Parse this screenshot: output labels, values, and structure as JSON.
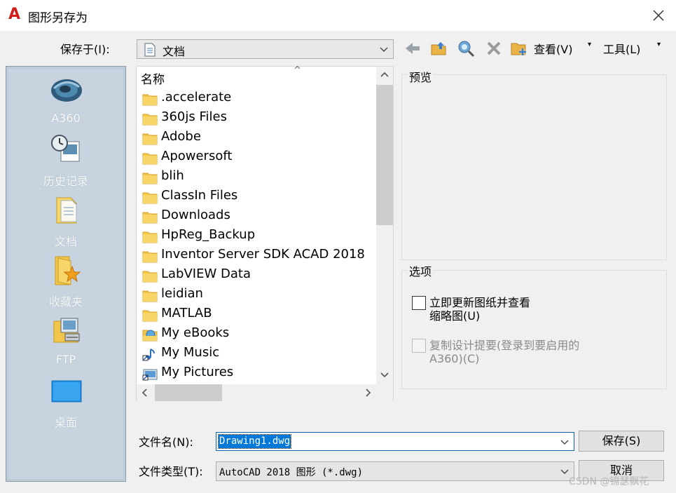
{
  "window": {
    "title": "图形另存为",
    "close_icon": "close-icon"
  },
  "toolbar": {
    "save_in_label": "保存于(I):",
    "location": "文档",
    "view_label": "查看(V)",
    "tools_label": "工具(L)",
    "icons": [
      "back-icon",
      "up-folder-icon",
      "search-web-icon",
      "delete-icon",
      "new-folder-icon"
    ]
  },
  "places": [
    {
      "label": "A360",
      "icon": "a360-icon"
    },
    {
      "label": "历史记录",
      "icon": "history-icon"
    },
    {
      "label": "文档",
      "icon": "documents-icon"
    },
    {
      "label": "收藏夹",
      "icon": "favorites-icon"
    },
    {
      "label": "FTP",
      "icon": "ftp-icon"
    },
    {
      "label": "桌面",
      "icon": "desktop-icon"
    }
  ],
  "file_list": {
    "column_header": "名称",
    "items": [
      {
        "name": ".accelerate",
        "icon": "folder-icon"
      },
      {
        "name": "360js Files",
        "icon": "folder-icon"
      },
      {
        "name": "Adobe",
        "icon": "folder-icon"
      },
      {
        "name": "Apowersoft",
        "icon": "folder-icon"
      },
      {
        "name": "blih",
        "icon": "folder-icon"
      },
      {
        "name": "ClassIn Files",
        "icon": "folder-icon"
      },
      {
        "name": "Downloads",
        "icon": "folder-icon"
      },
      {
        "name": "HpReg_Backup",
        "icon": "folder-icon"
      },
      {
        "name": "Inventor Server SDK ACAD 2018",
        "icon": "folder-icon"
      },
      {
        "name": "LabVIEW Data",
        "icon": "folder-icon"
      },
      {
        "name": "leidian",
        "icon": "folder-icon"
      },
      {
        "name": "MATLAB",
        "icon": "folder-icon"
      },
      {
        "name": "My eBooks",
        "icon": "ebooks-folder-icon"
      },
      {
        "name": "My Music",
        "icon": "music-shortcut-icon"
      },
      {
        "name": "My Pictures",
        "icon": "pictures-shortcut-icon"
      }
    ]
  },
  "preview": {
    "title": "预览"
  },
  "options": {
    "title": "选项",
    "update_thumbnail": {
      "line1": "立即更新图纸并查看",
      "line2": "缩略图(U)",
      "checked": false
    },
    "copy_design": {
      "line1": "复制设计提要(登录到要启用的",
      "line2": "A360)(C)",
      "checked": false,
      "disabled": true
    }
  },
  "footer": {
    "filename_label": "文件名(N):",
    "filename_value": "Drawing1.dwg",
    "filetype_label": "文件类型(T):",
    "filetype_value": "AutoCAD 2018 图形 (*.dwg)",
    "save_button": "保存(S)",
    "cancel_button": "取消"
  },
  "watermark": "CSDN @锦瑟飘花",
  "colors": {
    "accent": "#0078d7",
    "places_bg": "#c7d4e0",
    "folder": "#f3c64b"
  }
}
